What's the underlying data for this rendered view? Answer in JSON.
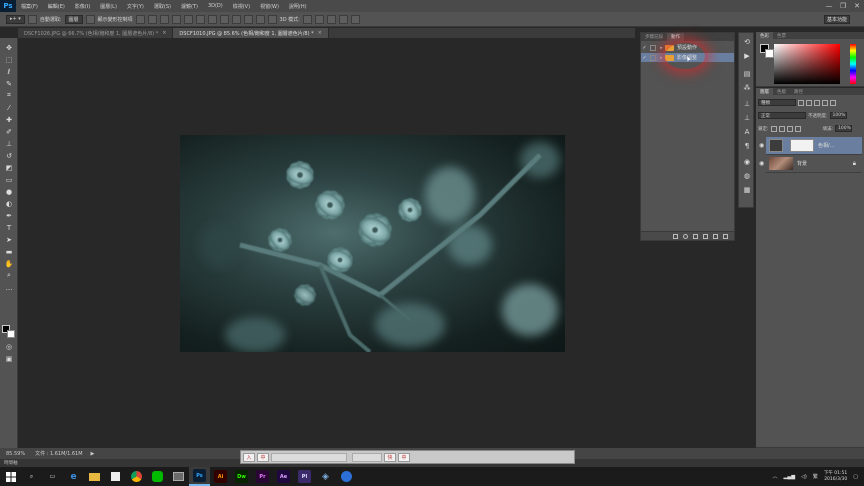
{
  "app": {
    "logo": "Ps",
    "workspace": "基本功能"
  },
  "menu": [
    "檔案(F)",
    "編輯(E)",
    "影像(I)",
    "圖層(L)",
    "文字(Y)",
    "選取(S)",
    "濾鏡(T)",
    "3D(D)",
    "檢視(V)",
    "視窗(W)",
    "說明(H)"
  ],
  "window_controls": {
    "minimize": "—",
    "restore": "❐",
    "close": "✕"
  },
  "options": {
    "auto_select_label": "自動選取:",
    "auto_select_value": "圖層",
    "transform_label": "顯示變形控制項",
    "mode_3d": "3D 模式:"
  },
  "tabs": [
    {
      "label": "DSCF1026.JPG @ 66.7% (色相/飽和度 1, 圖層遮色片/8) *",
      "close": "×"
    },
    {
      "label": "DSCF1010.JPG @ 85.6% (色相/飽和度 1, 圖層遮色片/8) *",
      "close": "×"
    }
  ],
  "actions_panel": {
    "tabs": [
      "步驟記錄",
      "動作"
    ],
    "rows": [
      {
        "check": "✓",
        "label": "預設動作"
      },
      {
        "check": "✓",
        "label": "影像調整"
      }
    ]
  },
  "color_panel": {
    "tabs": [
      "色彩",
      "色票"
    ]
  },
  "layers_panel": {
    "tabs": [
      "圖層",
      "色版",
      "路徑"
    ],
    "kind_filter": "種類",
    "blend_mode": "正常",
    "opacity_label": "不透明度:",
    "opacity_value": "100%",
    "lock_label": "鎖定:",
    "fill_label": "填滿:",
    "fill_value": "100%",
    "layers": [
      {
        "name": "色相/...",
        "type": "adjustment"
      },
      {
        "name": "背景",
        "type": "image"
      }
    ]
  },
  "status": {
    "zoom": "85.59%",
    "doc": "文件 : 1.61M/1.61M",
    "timeline": "時間軸"
  },
  "ime": {
    "left": [
      "入",
      "中"
    ],
    "right": [
      "快",
      "中"
    ]
  },
  "taskbar": {
    "apps": [
      {
        "name": "Ps",
        "color": "#31a8ff",
        "bg": "#0a1e33"
      },
      {
        "name": "Ai",
        "color": "#ff9a00",
        "bg": "#330000"
      },
      {
        "name": "Dw",
        "color": "#35fa00",
        "bg": "#072401"
      },
      {
        "name": "Pr",
        "color": "#e77bff",
        "bg": "#2a0634"
      },
      {
        "name": "Ae",
        "color": "#d8a1ff",
        "bg": "#1f0740"
      },
      {
        "name": "Pl",
        "color": "#e0e0ff",
        "bg": "#3c2b6b"
      }
    ],
    "time": "下午 01:51",
    "date": "2016/3/30",
    "lang": "繁"
  }
}
